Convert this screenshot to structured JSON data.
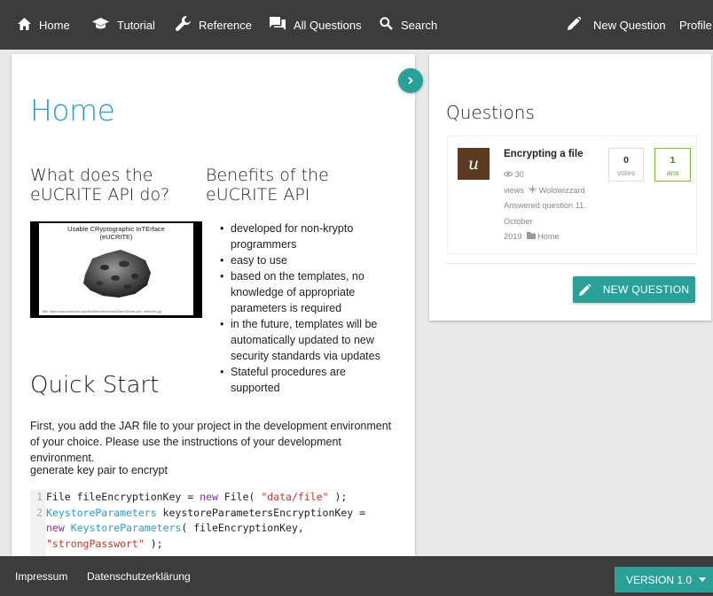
{
  "nav": {
    "items": [
      {
        "label": "Home",
        "icon": "home-icon"
      },
      {
        "label": "Tutorial",
        "icon": "graduation-cap-icon"
      },
      {
        "label": "Reference",
        "icon": "wrench-icon"
      },
      {
        "label": "All Questions",
        "icon": "forum-icon"
      },
      {
        "label": "Search",
        "icon": "search-icon"
      }
    ],
    "new_question": "New Question",
    "profile": "Profile"
  },
  "main": {
    "title": "Home",
    "what_heading": "What does the eUCRITE API do?",
    "benefits_heading": "Benefits of the eUCRITE API",
    "video": {
      "title_line1": "Usable CRyptographic InTErface",
      "title_line2": "(eUCRITE)",
      "footer": "Bild: https://www.wikimedia.org/wiki/Meteorite#/media/Datei:Sikhote-Alin_meteorite.jpg"
    },
    "benefits": [
      "developed for non-krypto programmers",
      "easy to use",
      "based on the templates, no knowledge of appropriate parameters is required",
      "in the future, templates will be automatically updated to new security standards via updates",
      "Stateful procedures are supported"
    ],
    "quick_start_heading": "Quick Start",
    "paragraph1": "First, you add the JAR file to your project in the development environment of your choice. Please use the instructions of your development environment.",
    "paragraph2": "generate key pair to encrypt",
    "code": {
      "line_numbers": [
        "1",
        "2"
      ],
      "l1_a": "File fileEncryptionKey = ",
      "l1_kw": "new",
      "l1_b": " File( ",
      "l1_str": "\"data/file\"",
      "l1_c": " );",
      "l2_cls": "KeystoreParameters",
      "l2_a": " keystoreParametersEncryptionKey =",
      "l3_kw": "new",
      "l3_sp": " ",
      "l3_cls": "KeystoreParameters",
      "l3_a": "( fileEncryptionKey,",
      "l4_str": "\"strongPasswort\"",
      "l4_a": " );"
    }
  },
  "side": {
    "title": "Questions",
    "question": {
      "avatar_letter": "u",
      "title": "Encrypting a file",
      "views_count": "30",
      "views_label": "views",
      "author": "Wolowizzard",
      "answered_label": "Answered question 11.",
      "month": "October",
      "year": "2019",
      "category": "Home",
      "votes": "0",
      "votes_label": "votes",
      "answers": "1",
      "answers_label": "ans"
    },
    "new_question_button": "NEW QUESTION"
  },
  "footer": {
    "impressum": "Impressum",
    "privacy": "Datenschutzerklärung",
    "version": "VERSION 1.0"
  },
  "colors": {
    "accent": "#2aa198",
    "title_blue": "#2a9bd8",
    "navbar": "#3c3c3c"
  }
}
